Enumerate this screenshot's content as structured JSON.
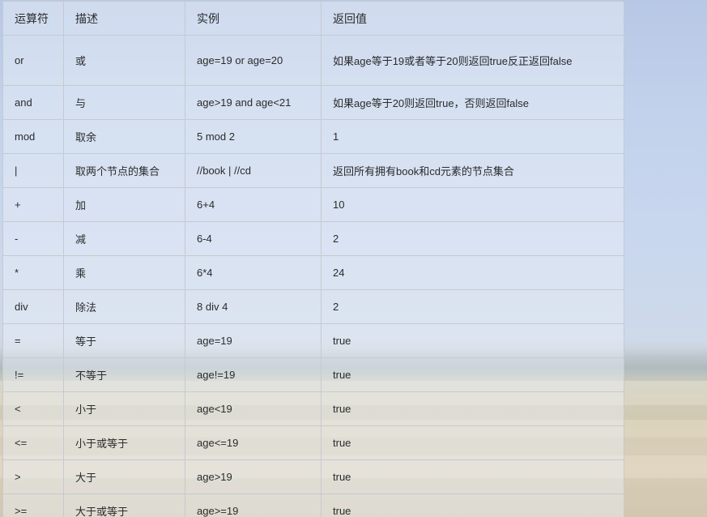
{
  "table": {
    "headers": [
      "运算符",
      "描述",
      "实例",
      "返回值"
    ],
    "rows": [
      [
        "or",
        "或",
        "age=19 or age=20",
        "如果age等于19或者等于20则返回true反正返回false"
      ],
      [
        "and",
        "与",
        "age>19 and age<21",
        "如果age等于20则返回true，否则返回false"
      ],
      [
        "mod",
        "取余",
        "5 mod 2",
        "1"
      ],
      [
        "|",
        "取两个节点的集合",
        "//book | //cd",
        "返回所有拥有book和cd元素的节点集合"
      ],
      [
        "+",
        "加",
        "6+4",
        "10"
      ],
      [
        "-",
        "减",
        "6-4",
        "2"
      ],
      [
        "*",
        "乘",
        "6*4",
        "24"
      ],
      [
        "div",
        "除法",
        "8 div 4",
        "2"
      ],
      [
        "=",
        "等于",
        "age=19",
        "true"
      ],
      [
        "!=",
        "不等于",
        "age!=19",
        "true"
      ],
      [
        "<",
        "小于",
        "age<19",
        "true"
      ],
      [
        "<=",
        "小于或等于",
        "age<=19",
        "true"
      ],
      [
        ">",
        "大于",
        "age>19",
        "true"
      ],
      [
        ">=",
        "大于或等于",
        "age>=19",
        "true"
      ]
    ]
  }
}
